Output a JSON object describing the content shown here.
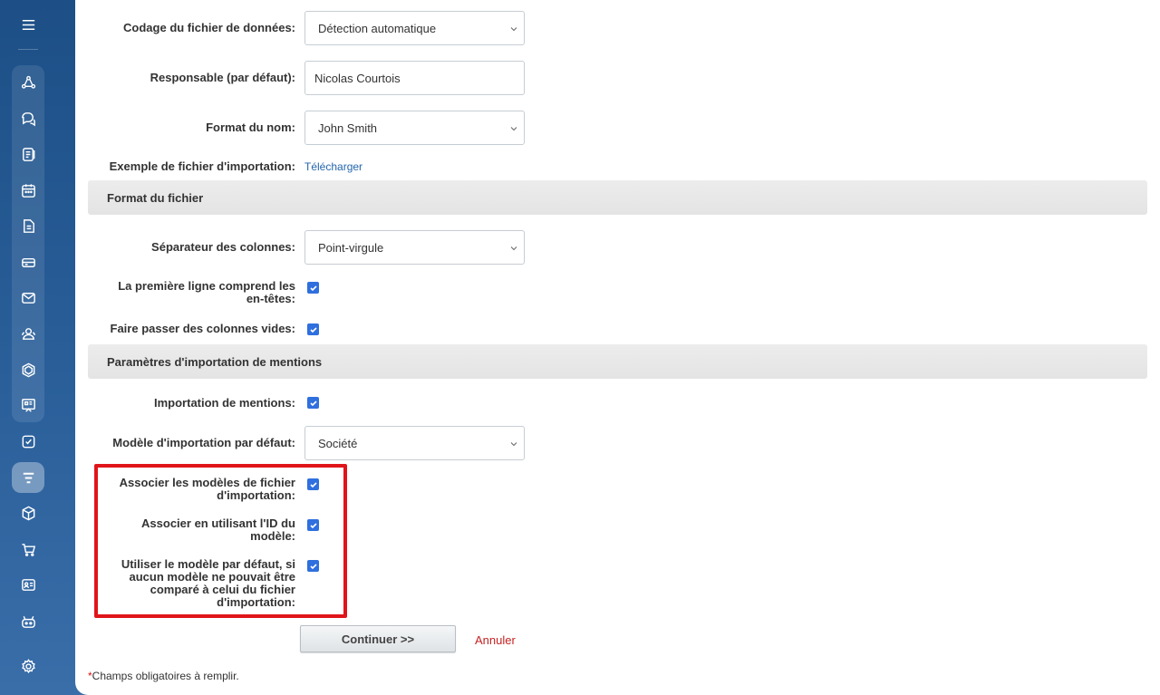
{
  "sidebar": {
    "items": [
      {
        "icon": "menu-icon"
      },
      {
        "icon": "network-icon"
      },
      {
        "icon": "chat-icon"
      },
      {
        "icon": "feed-icon"
      },
      {
        "icon": "calendar-icon"
      },
      {
        "icon": "document-icon"
      },
      {
        "icon": "drive-icon"
      },
      {
        "icon": "mail-icon"
      },
      {
        "icon": "contacts-icon"
      },
      {
        "icon": "hexagon-icon"
      },
      {
        "icon": "presentation-icon"
      },
      {
        "icon": "tasks-icon"
      },
      {
        "icon": "crm-filter-icon",
        "active": true
      },
      {
        "icon": "package-icon"
      },
      {
        "icon": "cart-icon"
      },
      {
        "icon": "contact-card-icon"
      },
      {
        "icon": "robot-icon"
      },
      {
        "icon": "settings-icon"
      }
    ]
  },
  "form": {
    "encoding": {
      "label": "Codage du fichier de données:",
      "value": "Détection automatique"
    },
    "responsible": {
      "label": "Responsable (par défaut):",
      "value": "Nicolas Courtois"
    },
    "name_format": {
      "label": "Format du nom:",
      "value": "John Smith"
    },
    "sample_file": {
      "label": "Exemple de fichier d'importation:",
      "link": "Télécharger"
    },
    "section_file_format": "Format du fichier",
    "separator": {
      "label": "Séparateur des colonnes:",
      "value": "Point-virgule"
    },
    "first_line_headers": {
      "label_line1": "La première ligne comprend les",
      "label_line2": "en-têtes:",
      "checked": true
    },
    "skip_empty": {
      "label": "Faire passer des colonnes vides:",
      "checked": true
    },
    "section_mentions": "Paramètres d'importation de mentions",
    "import_mentions": {
      "label": "Importation de mentions:",
      "checked": true
    },
    "default_template": {
      "label": "Modèle d'importation par défaut:",
      "value": "Société"
    },
    "associate_templates": {
      "label_line1": "Associer les modèles de fichier",
      "label_line2": "d'importation:",
      "checked": true
    },
    "associate_by_id": {
      "label_line1": "Associer en utilisant l'ID du",
      "label_line2": "modèle:",
      "checked": true
    },
    "use_default": {
      "label_line1": "Utiliser le modèle par défaut, si",
      "label_line2": "aucun modèle ne pouvait être",
      "label_line3": "comparé à celui du fichier",
      "label_line4": "d'importation:",
      "checked": true
    }
  },
  "actions": {
    "continue_label": "Continuer >>",
    "cancel_label": "Annuler"
  },
  "footnote": {
    "star": "*",
    "text": "Champs obligatoires à remplir."
  },
  "colors": {
    "accent": "#2f6fde",
    "highlight": "#e0151a",
    "link": "#2466ad",
    "cancel": "#c52222"
  }
}
